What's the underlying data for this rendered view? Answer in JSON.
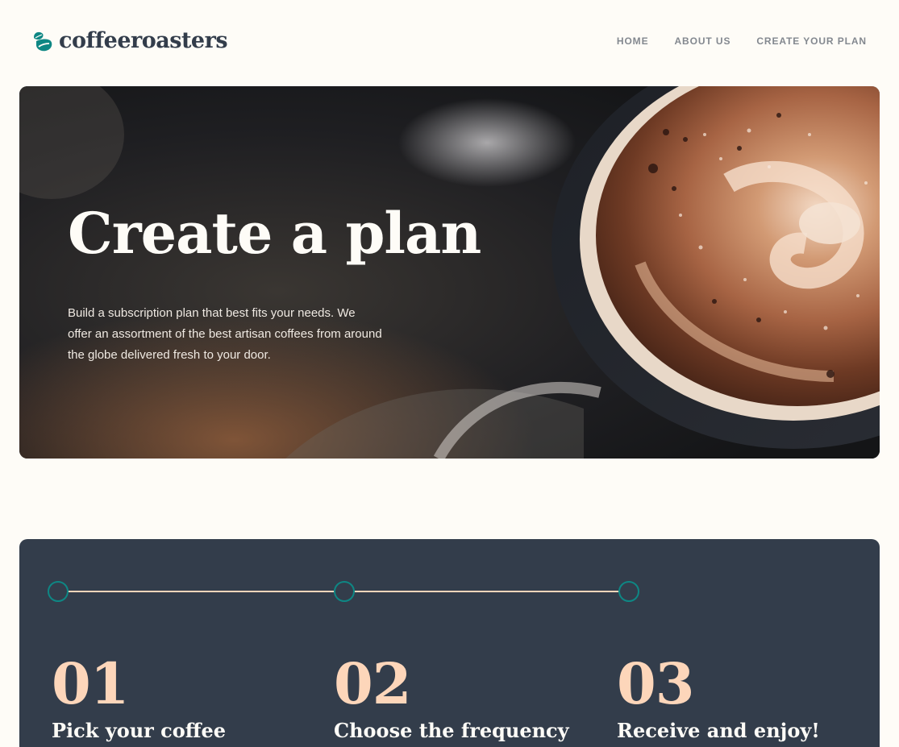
{
  "brand": {
    "name": "coffeeroasters",
    "logo_icon": "coffee-bean-icon",
    "colors": {
      "accent": "#0E8784",
      "dark": "#333D4B",
      "peach": "#FDD6BA",
      "light": "#FEFCF7",
      "grey": "#83888F"
    }
  },
  "nav": {
    "items": [
      {
        "label": "HOME"
      },
      {
        "label": "ABOUT US"
      },
      {
        "label": "CREATE YOUR PLAN"
      }
    ]
  },
  "hero": {
    "title": "Create a plan",
    "description": "Build a subscription plan that best fits your needs. We offer an assortment of the best artisan coffees from around the globe delivered fresh to your door."
  },
  "steps": {
    "items": [
      {
        "number": "01",
        "title": "Pick your coffee"
      },
      {
        "number": "02",
        "title": "Choose the frequency"
      },
      {
        "number": "03",
        "title": "Receive and enjoy!"
      }
    ]
  }
}
